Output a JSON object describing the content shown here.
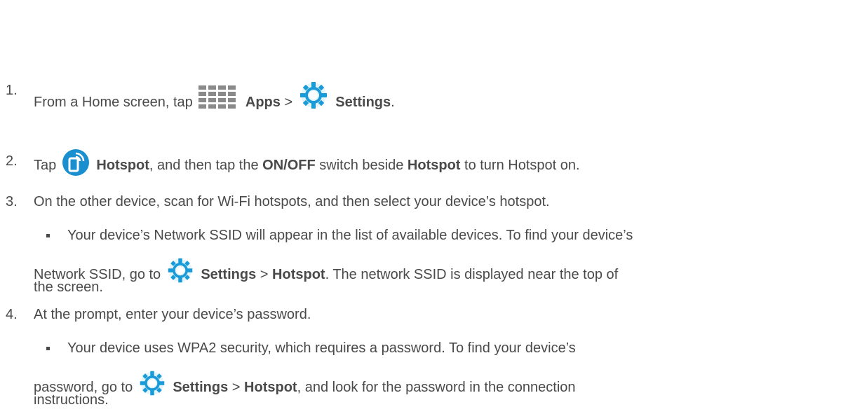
{
  "steps": [
    {
      "number": "1.",
      "pre": "From a Home screen, tap",
      "apps": "Apps",
      "sep": ">",
      "settings": "Settings",
      "end": "."
    },
    {
      "number": "2.",
      "pre": "Tap",
      "hotspot": "Hotspot",
      "mid": ", and then tap the",
      "onoff": "ON/OFF",
      "mid2": "switch beside",
      "hotspot2": "Hotspot",
      "end": "to turn Hotspot on."
    },
    {
      "number": "3.",
      "text": "On the other device, scan for Wi-Fi hotspots, and then select your device’s hotspot.",
      "bullet": {
        "line1": "Your device’s Network SSID will appear in the list of available devices. To find your device’s",
        "pre": "Network SSID, go to",
        "settings": "Settings",
        "sep": ">",
        "hotspot": "Hotspot",
        "post": ". The network SSID is displayed near the top of",
        "line3": "the screen."
      }
    },
    {
      "number": "4.",
      "text": "At the prompt, enter your device’s password.",
      "bullet": {
        "line1": "Your device uses WPA2 security, which requires a password. To find your device’s",
        "pre": "password, go to",
        "settings": "Settings",
        "sep": ">",
        "hotspot": "Hotspot",
        "post": ", and look for the password in the connection",
        "line3": "instructions."
      }
    }
  ],
  "colors": {
    "text": "#4a4a4a",
    "settings_icon": "#1a9bd7",
    "hotspot_icon": "#1a8fcf",
    "apps_icon": "#8a8a8a"
  },
  "icons": [
    "apps-grid-icon",
    "settings-gear-icon",
    "hotspot-icon"
  ]
}
